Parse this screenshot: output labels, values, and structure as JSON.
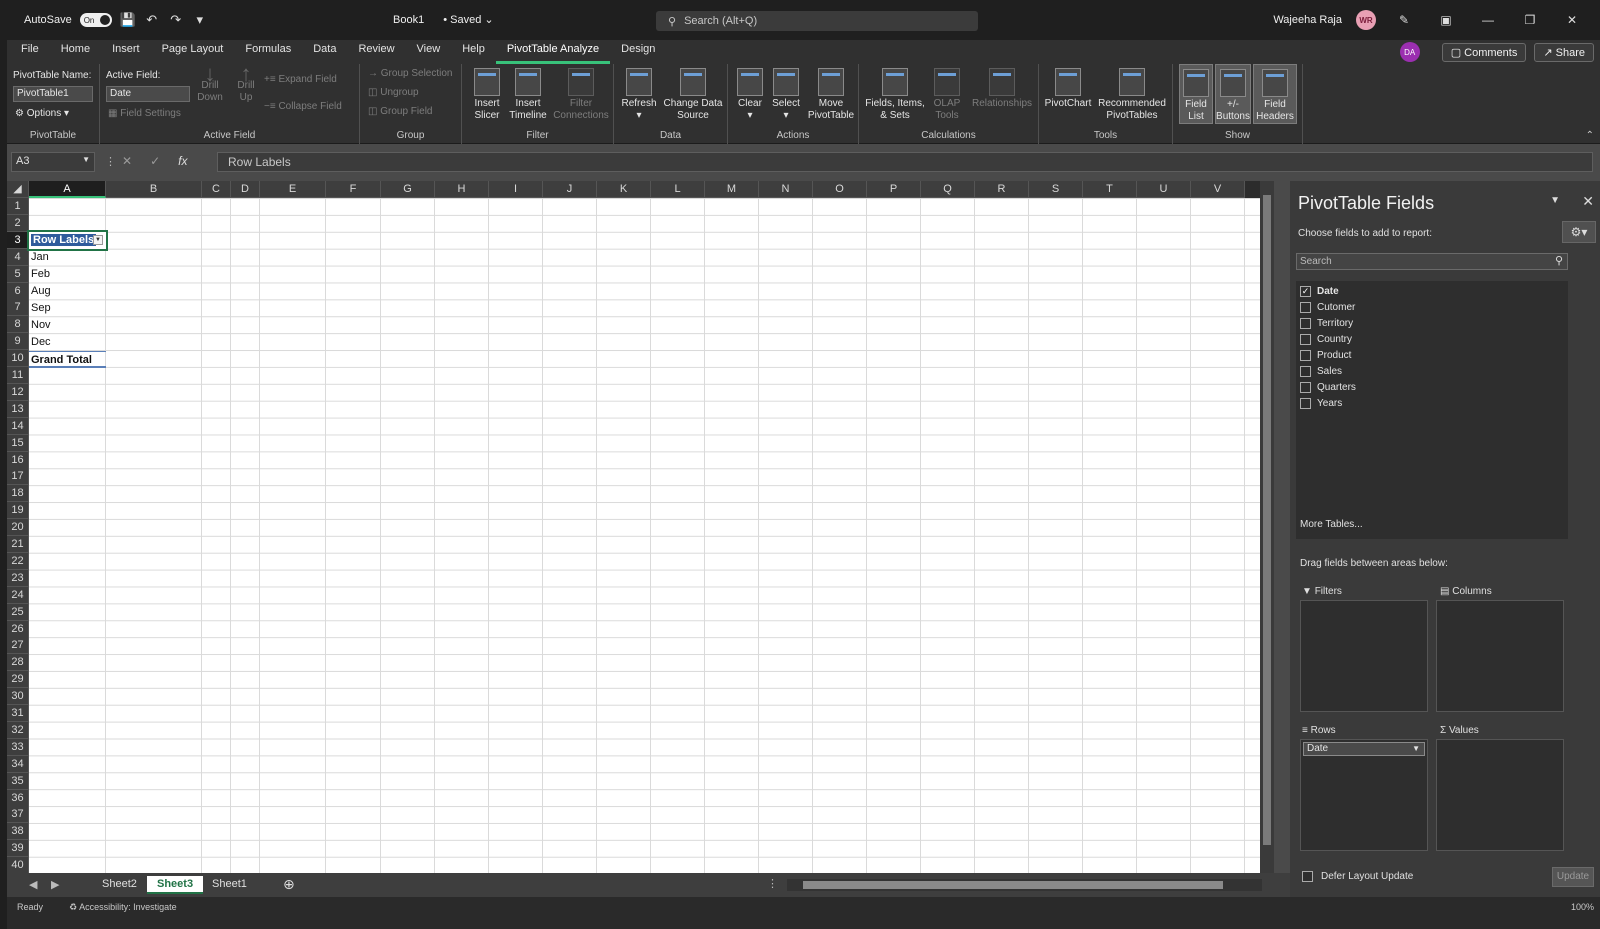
{
  "titlebar": {
    "autosave_label": "AutoSave",
    "autosave_state": "On",
    "doc_title": "Book1",
    "saved_label": "• Saved",
    "search_placeholder": "Search (Alt+Q)",
    "user_name": "Wajeeha Raja",
    "user_initials": "WR"
  },
  "tabs": [
    "File",
    "Home",
    "Insert",
    "Page Layout",
    "Formulas",
    "Data",
    "Review",
    "View",
    "Help",
    "PivotTable Analyze",
    "Design"
  ],
  "tabs_right": {
    "user_initials": "DA",
    "comments": "Comments",
    "share": "Share"
  },
  "ribbon": {
    "pivottable": {
      "name_label": "PivotTable Name:",
      "name_value": "PivotTable1",
      "options": "Options",
      "group": "PivotTable"
    },
    "active_field": {
      "label": "Active Field:",
      "value": "Date",
      "field_settings": "Field Settings",
      "drill_down": "Drill Down",
      "drill_up": "Drill Up",
      "expand_field": "Expand Field",
      "collapse_field": "Collapse Field",
      "group": "Active Field"
    },
    "group_grp": {
      "group_selection": "Group Selection",
      "ungroup": "Ungroup",
      "group_field": "Group Field",
      "group": "Group"
    },
    "filter": {
      "insert_slicer": "Insert Slicer",
      "insert_timeline": "Insert Timeline",
      "filter_connections": "Filter Connections",
      "group": "Filter"
    },
    "data": {
      "refresh": "Refresh",
      "change_data_source": "Change Data Source",
      "group": "Data"
    },
    "actions": {
      "clear": "Clear",
      "select": "Select",
      "move_pivottable": "Move PivotTable",
      "group": "Actions"
    },
    "calculations": {
      "fields_items_sets": "Fields, Items, & Sets",
      "olap_tools": "OLAP Tools",
      "relationships": "Relationships",
      "group": "Calculations"
    },
    "tools": {
      "pivotchart": "PivotChart",
      "recommended": "Recommended PivotTables",
      "group": "Tools"
    },
    "show": {
      "field_list": "Field List",
      "buttons": "+/- Buttons",
      "field_headers": "Field Headers",
      "group": "Show"
    }
  },
  "formula_bar": {
    "name_box": "A3",
    "fx": "fx",
    "content": "Row Labels"
  },
  "columns": [
    "A",
    "B",
    "C",
    "D",
    "E",
    "F",
    "G",
    "H",
    "I",
    "J",
    "K",
    "L",
    "M",
    "N",
    "O",
    "P",
    "Q",
    "R",
    "S",
    "T",
    "U",
    "V"
  ],
  "rows": [
    "1",
    "2",
    "3",
    "4",
    "5",
    "6",
    "7",
    "8",
    "9",
    "10",
    "11",
    "12",
    "13",
    "14",
    "15",
    "16",
    "17",
    "18",
    "19",
    "20",
    "21",
    "22",
    "23",
    "24",
    "25",
    "26",
    "27",
    "28",
    "29",
    "30",
    "31",
    "32",
    "33",
    "34",
    "35",
    "36",
    "37",
    "38",
    "39",
    "40"
  ],
  "pivot_cells": {
    "header": "Row Labels",
    "items": [
      "Jan",
      "Feb",
      "Aug",
      "Sep",
      "Nov",
      "Dec"
    ],
    "total": "Grand Total"
  },
  "sheet_tabs": [
    "Sheet2",
    "Sheet3",
    "Sheet1"
  ],
  "status": {
    "ready": "Ready",
    "accessibility": "Accessibility: Investigate",
    "zoom": "100%"
  },
  "pane": {
    "title": "PivotTable Fields",
    "subtitle": "Choose fields to add to report:",
    "search_placeholder": "Search",
    "fields": [
      {
        "name": "Date",
        "checked": true
      },
      {
        "name": "Cutomer",
        "checked": false
      },
      {
        "name": "Territory",
        "checked": false
      },
      {
        "name": "Country",
        "checked": false
      },
      {
        "name": "Product",
        "checked": false
      },
      {
        "name": "Sales",
        "checked": false
      },
      {
        "name": "Quarters",
        "checked": false
      },
      {
        "name": "Years",
        "checked": false
      }
    ],
    "more_tables": "More Tables...",
    "drag_label": "Drag fields between areas below:",
    "filters": "Filters",
    "columns": "Columns",
    "rows": "Rows",
    "values": "Values",
    "rows_field": "Date",
    "defer": "Defer Layout Update",
    "update": "Update"
  }
}
